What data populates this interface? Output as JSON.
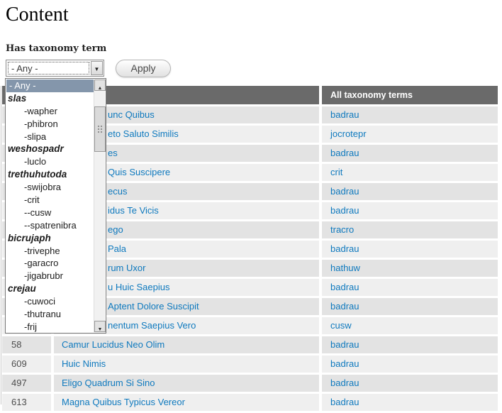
{
  "page": {
    "title": "Content"
  },
  "filter": {
    "label": "Has taxonomy term",
    "selected_value": "- Any -",
    "apply_label": "Apply"
  },
  "icons": {
    "chevron_down": "▼",
    "triangle_up": "▲",
    "triangle_down": "▼"
  },
  "dropdown": {
    "items": [
      {
        "label": "- Any -",
        "type": "option",
        "selected": true
      },
      {
        "label": "slas",
        "type": "group"
      },
      {
        "label": "-wapher",
        "type": "option"
      },
      {
        "label": "-phibron",
        "type": "option"
      },
      {
        "label": "-slipa",
        "type": "option"
      },
      {
        "label": "weshospadr",
        "type": "group"
      },
      {
        "label": "-luclo",
        "type": "option"
      },
      {
        "label": "trethuhutoda",
        "type": "group"
      },
      {
        "label": "-swijobra",
        "type": "option"
      },
      {
        "label": "-crit",
        "type": "option"
      },
      {
        "label": "--cusw",
        "type": "option"
      },
      {
        "label": "--spatrenibra",
        "type": "option"
      },
      {
        "label": "bicrujaph",
        "type": "group"
      },
      {
        "label": "-trivephe",
        "type": "option"
      },
      {
        "label": "-garacro",
        "type": "option"
      },
      {
        "label": "-jigabrubr",
        "type": "option"
      },
      {
        "label": "crejau",
        "type": "group"
      },
      {
        "label": "-cuwoci",
        "type": "option"
      },
      {
        "label": "-thutranu",
        "type": "option"
      },
      {
        "label": "-frij",
        "type": "option"
      }
    ]
  },
  "table": {
    "headers": {
      "id": "",
      "title": "",
      "terms": "All taxonomy terms"
    },
    "rows": [
      {
        "id": "",
        "title": "unc Quibus",
        "term": "badrau"
      },
      {
        "id": "",
        "title": "eto Saluto Similis",
        "term": "jocrotepr"
      },
      {
        "id": "",
        "title": "es",
        "term": "badrau"
      },
      {
        "id": "",
        "title": "Quis Suscipere",
        "term": "crit"
      },
      {
        "id": "",
        "title": "ecus",
        "term": "badrau"
      },
      {
        "id": "",
        "title": "idus Te Vicis",
        "term": "badrau"
      },
      {
        "id": "",
        "title": "ego",
        "term": "tracro"
      },
      {
        "id": "",
        "title": "Pala",
        "term": "badrau"
      },
      {
        "id": "",
        "title": "rum Uxor",
        "term": "hathuw"
      },
      {
        "id": "",
        "title": "u Huic Saepius",
        "term": "badrau"
      },
      {
        "id": "",
        "title": "Aptent Dolore Suscipit",
        "term": "badrau"
      },
      {
        "id": "",
        "title": "nentum Saepius Vero",
        "term": "cusw"
      },
      {
        "id": "58",
        "title": "Camur Lucidus Neo Olim",
        "term": "badrau"
      },
      {
        "id": "609",
        "title": "Huic Nimis",
        "term": "badrau"
      },
      {
        "id": "497",
        "title": "Eligo Quadrum Si Sino",
        "term": "badrau"
      },
      {
        "id": "613",
        "title": "Magna Quibus Typicus Vereor",
        "term": "badrau"
      }
    ]
  },
  "colors": {
    "link": "#0e79be",
    "table_header_bg": "#6a6a6a",
    "row_odd_bg": "#e3e3e3",
    "row_even_bg": "#efefef",
    "dropdown_selected_bg": "#8496ab"
  }
}
